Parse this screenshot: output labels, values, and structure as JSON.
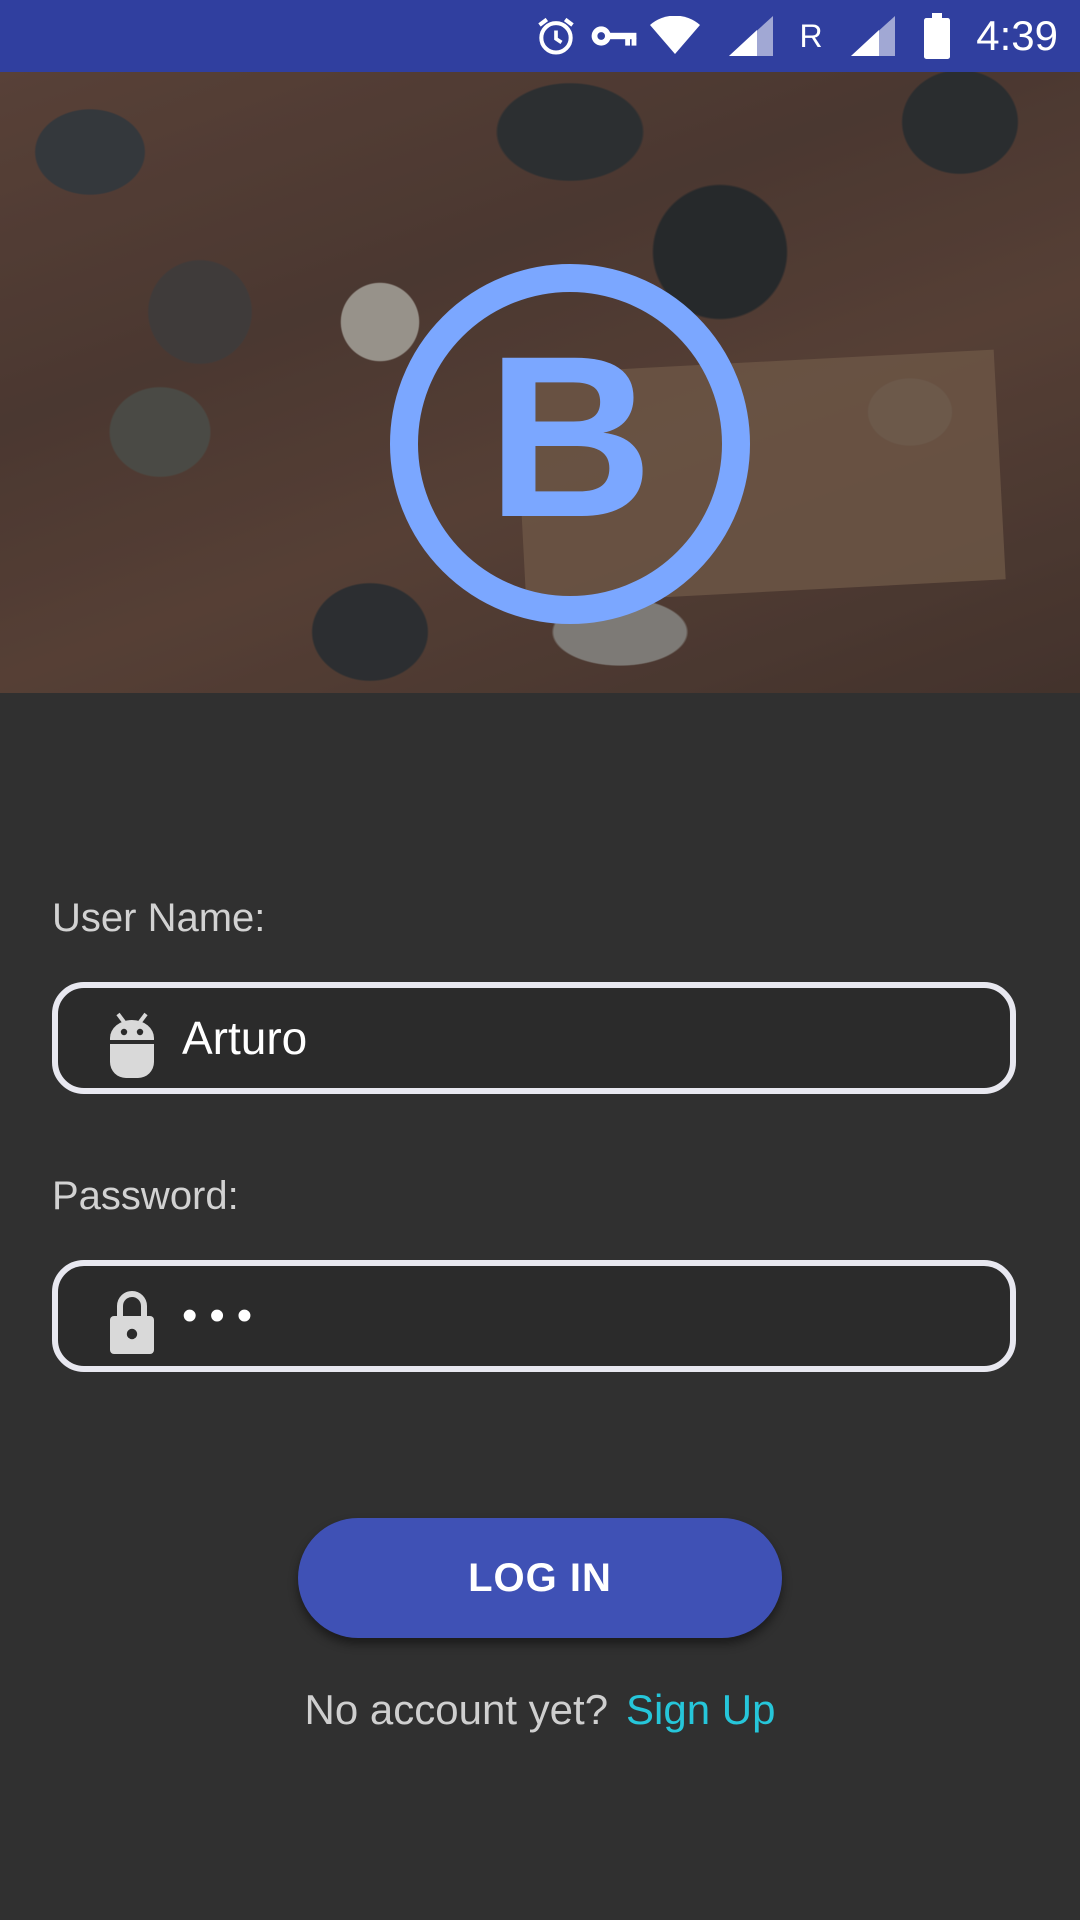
{
  "status_bar": {
    "time": "4:39",
    "carrier_label": "R",
    "icons": [
      "alarm-icon",
      "vpn-key-icon",
      "wifi-icon",
      "signal-icon",
      "signal-icon",
      "battery-icon"
    ],
    "background": "#303f9f"
  },
  "hero": {
    "logo_letter": "B",
    "logo_color": "#7ba7ff"
  },
  "form": {
    "username": {
      "label": "User Name:",
      "value": "Arturo",
      "icon": "android-icon"
    },
    "password": {
      "label": "Password:",
      "value": "•••",
      "icon": "lock-icon"
    },
    "login_button": "LOG IN",
    "signup_prompt": "No account yet?",
    "signup_link": "Sign Up"
  },
  "colors": {
    "background": "#303030",
    "accent": "#3f51b5",
    "link": "#26c6da",
    "field_border": "#e8e8f0"
  }
}
